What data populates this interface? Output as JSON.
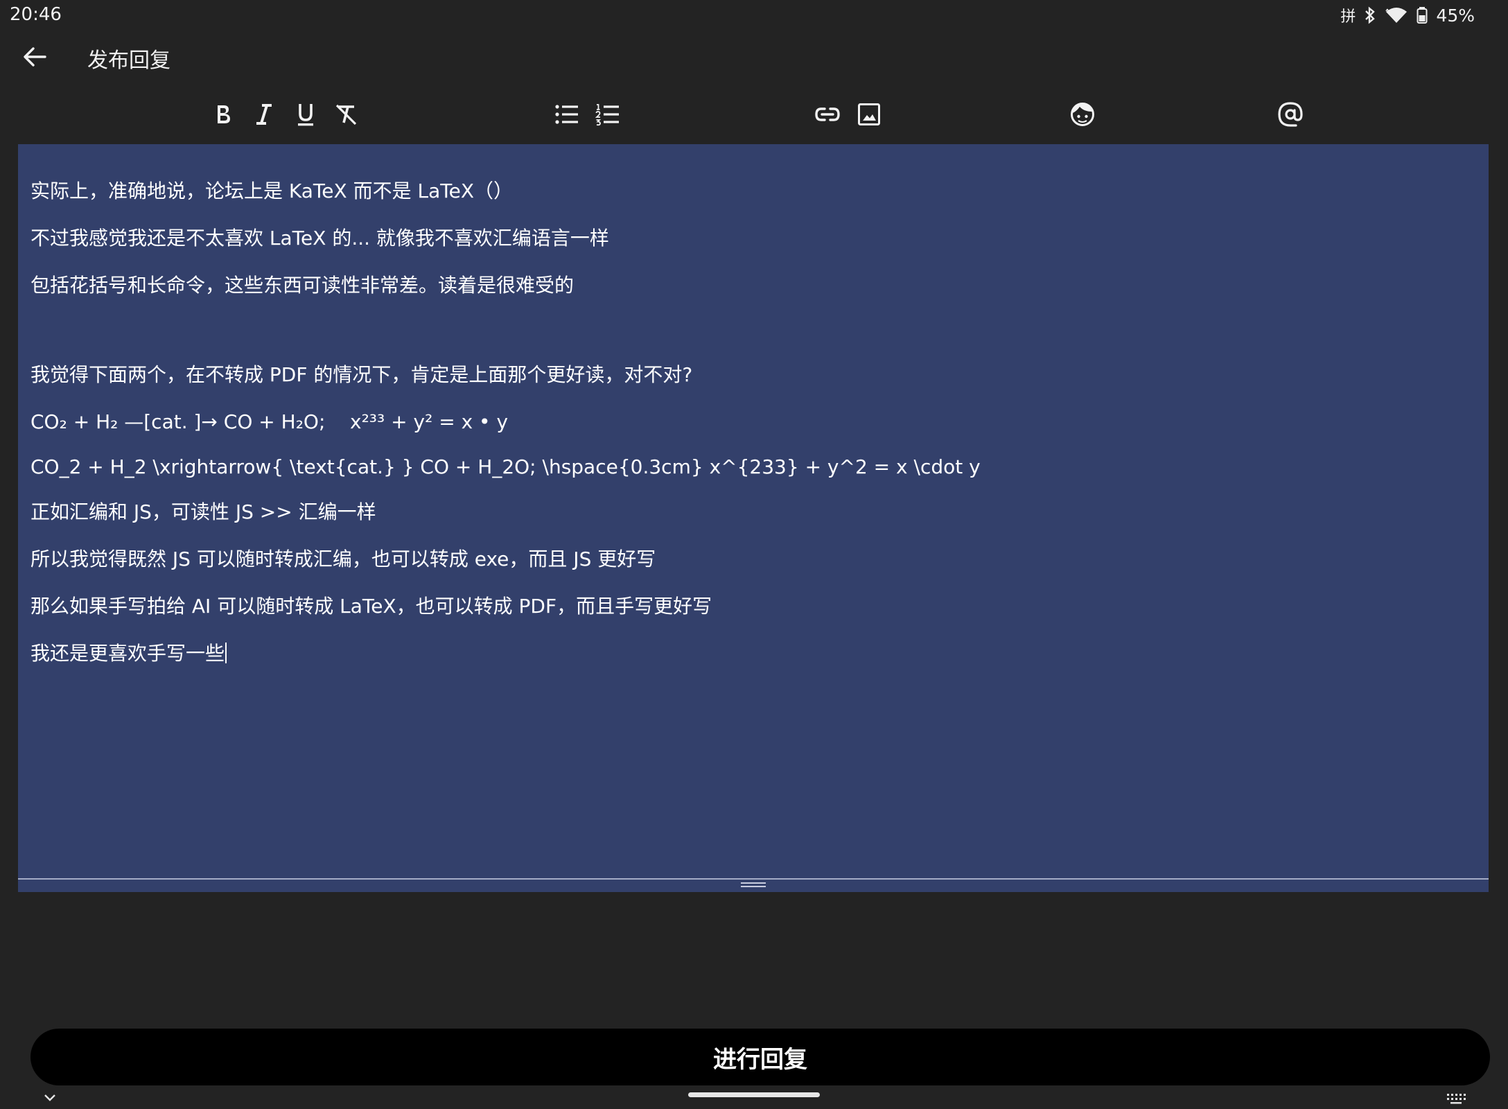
{
  "status_bar": {
    "time": "20:46",
    "input_method": "拼",
    "battery": "45%"
  },
  "app_bar": {
    "title": "发布回复"
  },
  "toolbar": {
    "icons": [
      "bold-icon",
      "italic-icon",
      "underline-icon",
      "clear-format-icon",
      "bullet-list-icon",
      "numbered-list-icon",
      "link-icon",
      "image-icon",
      "emoji-icon",
      "mention-icon"
    ]
  },
  "editor": {
    "lines": [
      "实际上，准确地说，论坛上是 KaTeX 而不是 LaTeX（）",
      "不过我感觉我还是不太喜欢 LaTeX 的... 就像我不喜欢汇编语言一样",
      "包括花括号和长命令，这些东西可读性非常差。读着是很难受的",
      "我觉得下面两个，在不转成 PDF 的情况下，肯定是上面那个更好读，对不对?",
      "CO₂ + H₂ —[cat. ]→ CO + H₂O;    x²³³ + y² = x • y",
      "CO_2 + H_2 \\xrightarrow{ \\text{cat.} } CO + H_2O; \\hspace{0.3cm} x^{233} + y^2 = x \\cdot y",
      "正如汇编和 JS，可读性 JS >> 汇编一样",
      "所以我觉得既然 JS 可以随时转成汇编，也可以转成 exe，而且 JS 更好写",
      "那么如果手写拍给 AI 可以随时转成 LaTeX，也可以转成 PDF，而且手写更好写",
      "我还是更喜欢手写一些"
    ]
  },
  "submit_button": {
    "label": "进行回复"
  },
  "colors": {
    "background": "#232323",
    "editor_background": "#33406b",
    "button_background": "#000000",
    "text": "#ffffff"
  }
}
